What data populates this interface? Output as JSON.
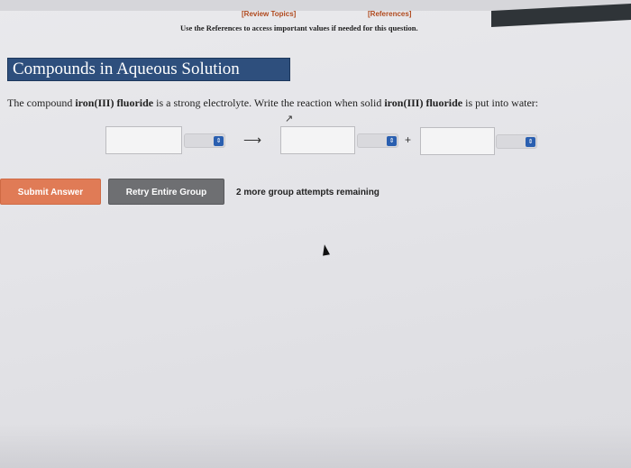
{
  "header": {
    "review_topics": "[Review Topics]",
    "references": "[References]",
    "instructions": "Use the References to access important values if needed for this question."
  },
  "section": {
    "title": "Compounds in Aqueous Solution"
  },
  "question": {
    "part1": "The compound ",
    "compound1": "iron(III) fluoride",
    "part2": " is a strong electrolyte. Write the reaction when solid ",
    "compound2": "iron(III) fluoride",
    "part3": " is put into water:"
  },
  "reaction": {
    "reactant_value": "",
    "reactant_state": "",
    "arrow": "⟶",
    "product1_value": "",
    "product1_state": "",
    "plus": "+",
    "product2_value": "",
    "product2_state": ""
  },
  "actions": {
    "submit_label": "Submit Answer",
    "retry_label": "Retry Entire Group",
    "attempts_text": "2 more group attempts remaining"
  },
  "colors": {
    "section_title_bg": "#2e4f7d",
    "submit_bg": "#e07b56",
    "retry_bg": "#6e6f72",
    "select_button": "#2a5fb0"
  },
  "icons": {
    "state_dropdown": "up-down-arrows-icon",
    "cursor": "mouse-pointer-icon"
  }
}
